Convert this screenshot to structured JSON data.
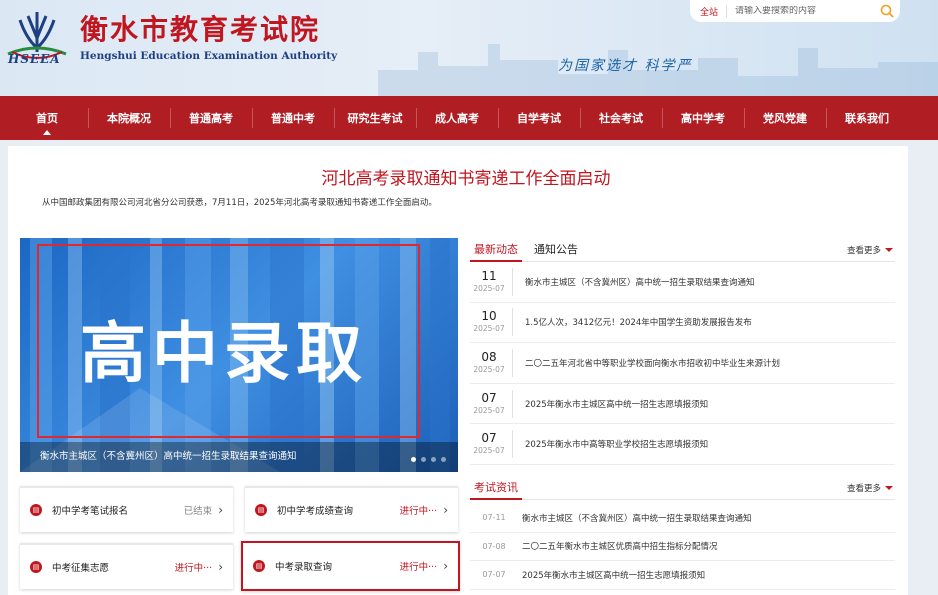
{
  "header": {
    "title": "衡水市教育考试院",
    "subtitle": "Hengshui Education Examination Authority",
    "logo_abbr": "HSEEA",
    "slogan": "为国家选才 科学严",
    "search": {
      "scope": "全站",
      "placeholder": "请输入要搜索的内容"
    }
  },
  "nav": {
    "items": [
      "首页",
      "本院概况",
      "普通高考",
      "普通中考",
      "研究生考试",
      "成人高考",
      "自学考试",
      "社会考试",
      "高中学考",
      "党风党建",
      "联系我们"
    ]
  },
  "headline": {
    "title": "河北高考录取通知书寄递工作全面启动",
    "lead": "从中国邮政集团有限公司河北省分公司获悉，7月11日，2025年河北高考录取通知书寄递工作全面启动。"
  },
  "banner": {
    "text": "高中录取",
    "caption": "衡水市主城区（不含冀州区）高中统一招生录取结果查询通知",
    "slide_count": 4,
    "active_slide": 1
  },
  "news": {
    "tabs": [
      "最新动态",
      "通知公告"
    ],
    "more": "查看更多",
    "items": [
      {
        "day": "11",
        "ym": "2025-07",
        "title": "衡水市主城区（不含冀州区）高中统一招生录取结果查询通知"
      },
      {
        "day": "10",
        "ym": "2025-07",
        "title": "1.5亿人次，3412亿元！2024年中国学生资助发展报告发布"
      },
      {
        "day": "08",
        "ym": "2025-07",
        "title": "二〇二五年河北省中等职业学校面向衡水市招收初中毕业生来源计划"
      },
      {
        "day": "07",
        "ym": "2025-07",
        "title": "2025年衡水市主城区高中统一招生志愿填报须知"
      },
      {
        "day": "07",
        "ym": "2025-07",
        "title": "2025年衡水市中高等职业学校招生志愿填报须知"
      }
    ]
  },
  "exam": {
    "title": "考试资讯",
    "more": "查看更多",
    "items": [
      {
        "date": "07-11",
        "title": "衡水市主城区（不含冀州区）高中统一招生录取结果查询通知"
      },
      {
        "date": "07-08",
        "title": "二〇二五年衡水市主城区优质高中招生指标分配情况"
      },
      {
        "date": "07-07",
        "title": "2025年衡水市主城区高中统一招生志愿填报须知"
      }
    ]
  },
  "cards": [
    {
      "label": "初中学考笔试报名",
      "status": "已结束",
      "state": "done"
    },
    {
      "label": "初中学考成绩查询",
      "status": "进行中···",
      "state": "ongoing"
    },
    {
      "label": "中考征集志愿",
      "status": "进行中···",
      "state": "ongoing"
    },
    {
      "label": "中考录取查询",
      "status": "进行中···",
      "state": "ongoing"
    }
  ],
  "colors": {
    "brand_red": "#b01e23",
    "headline_red": "#c0161f",
    "navy": "#1f3f83"
  }
}
